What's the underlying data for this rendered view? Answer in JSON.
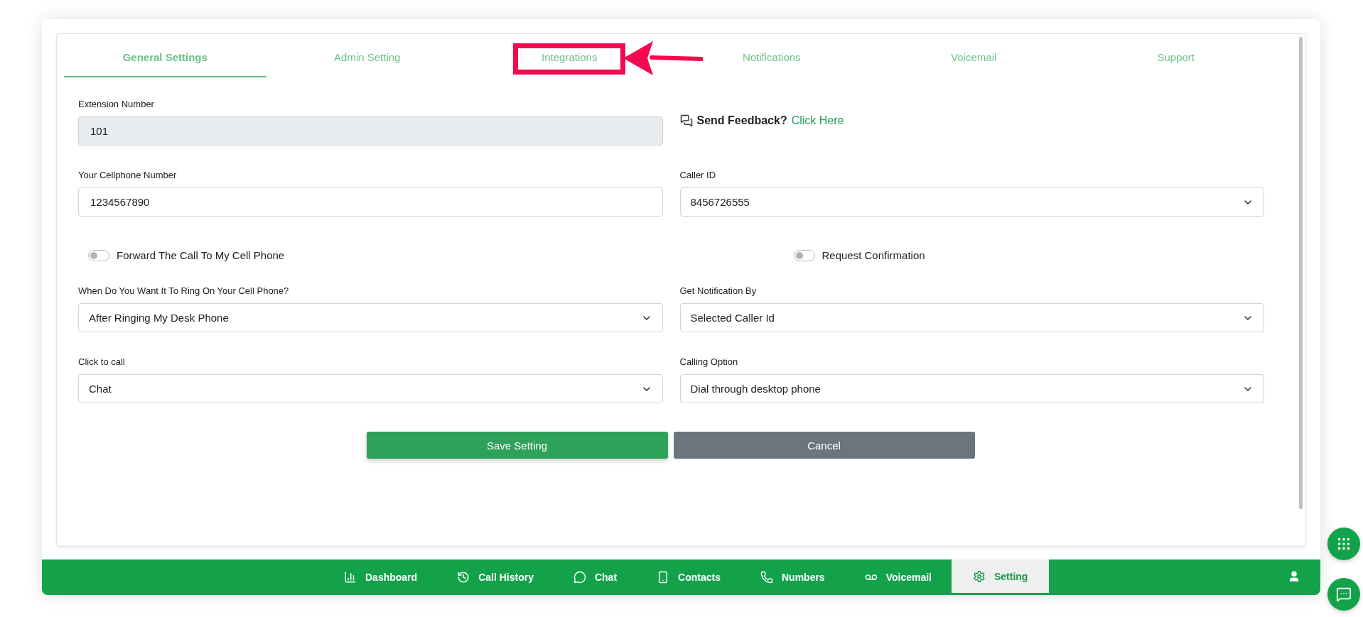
{
  "tabs": [
    {
      "label": "General Settings",
      "selected": true,
      "highlighted": false
    },
    {
      "label": "Admin Setting",
      "selected": false,
      "highlighted": false
    },
    {
      "label": "Integrations",
      "selected": false,
      "highlighted": true
    },
    {
      "label": "Notifications",
      "selected": false,
      "highlighted": false
    },
    {
      "label": "Voicemail",
      "selected": false,
      "highlighted": false
    },
    {
      "label": "Support",
      "selected": false,
      "highlighted": false
    }
  ],
  "extension": {
    "label": "Extension Number",
    "value": "101",
    "disabled": true
  },
  "feedback": {
    "text": "Send Feedback?",
    "link": "Click Here"
  },
  "cellphone": {
    "label": "Your Cellphone Number",
    "value": "1234567890"
  },
  "caller_id": {
    "label": "Caller ID",
    "value": "8456726555"
  },
  "toggles": [
    {
      "label": "Forward The Call To My Cell Phone",
      "on": false
    },
    {
      "label": "Request Confirmation",
      "on": false
    }
  ],
  "selects": [
    {
      "label": "When Do You Want It To Ring On Your Cell Phone?",
      "value": "After Ringing My Desk Phone"
    },
    {
      "label": "Get Notification By",
      "value": "Selected Caller Id"
    },
    {
      "label": "Click to call",
      "value": "Chat"
    },
    {
      "label": "Calling Option",
      "value": "Dial through desktop phone"
    }
  ],
  "buttons": [
    {
      "label": "Save Setting",
      "kind": "primary"
    },
    {
      "label": "Cancel",
      "kind": "secondary"
    }
  ],
  "nav": [
    {
      "label": "Dashboard",
      "selected": false
    },
    {
      "label": "Call History",
      "selected": false
    },
    {
      "label": "Chat",
      "selected": false
    },
    {
      "label": "Contacts",
      "selected": false
    },
    {
      "label": "Numbers",
      "selected": false
    },
    {
      "label": "Voicemail",
      "selected": false
    },
    {
      "label": "Setting",
      "selected": true
    }
  ]
}
